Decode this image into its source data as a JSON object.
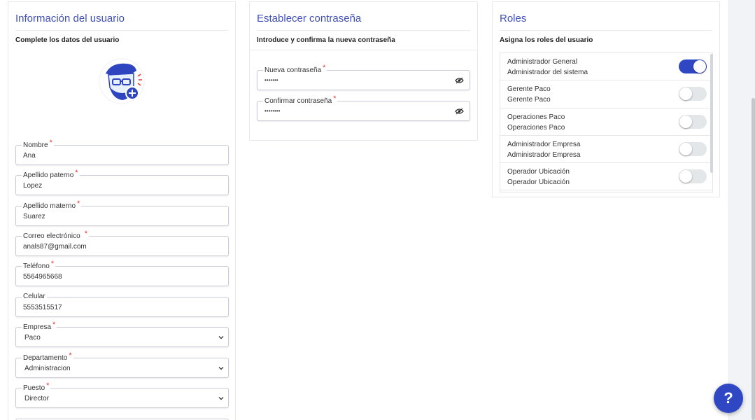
{
  "user_card": {
    "title": "Información del usuario",
    "subtitle": "Complete los datos del usuario",
    "fields": [
      {
        "label": "Nombre",
        "required": "*",
        "value": "Ana"
      },
      {
        "label": "Apellido paterno",
        "required": "*",
        "value": "Lopez"
      },
      {
        "label": "Apellido materno",
        "required": "*",
        "value": "Suarez"
      },
      {
        "label": "Correo electrónico",
        "required": "*",
        "value": "anals87@gmail.com"
      },
      {
        "label": "Teléfono",
        "required": "*",
        "value": "5564965668"
      },
      {
        "label": "Celular",
        "value": "5553515517"
      }
    ],
    "selects": [
      {
        "label": "Empresa",
        "required": "*",
        "value": "Paco"
      },
      {
        "label": "Departamento",
        "required": "*",
        "value": "Administracion"
      },
      {
        "label": "Puesto",
        "required": "*",
        "value": "Director"
      }
    ]
  },
  "password_card": {
    "title": "Establecer contraseña",
    "subtitle": "Introduce y confirma la nueva contraseña",
    "fields": [
      {
        "label": "Nueva contraseña",
        "required": "*",
        "value": "•••••••"
      },
      {
        "label": "Confirmar contraseña",
        "required": "*",
        "value": "••••••••"
      }
    ]
  },
  "roles_card": {
    "title": "Roles",
    "subtitle": "Asigna los roles del usuario",
    "roles": [
      {
        "name": "Administrador General",
        "description": "Administrador del sistema",
        "enabled": true
      },
      {
        "name": "Gerente Paco",
        "description": "Gerente Paco",
        "enabled": false
      },
      {
        "name": "Operaciones Paco",
        "description": "Operaciones Paco",
        "enabled": false
      },
      {
        "name": "Administrador Empresa",
        "description": "Administrador Empresa",
        "enabled": false
      },
      {
        "name": "Operador Ubicación",
        "description": "Operador Ubicación",
        "enabled": false
      }
    ]
  },
  "help_button": {
    "label": "?"
  },
  "colors": {
    "accent": "#3047c4",
    "title": "#3f51b5",
    "required": "#e53935"
  },
  "icons": [
    "user-avatar-icon",
    "eye-icon",
    "chevron-down-icon",
    "help-icon"
  ]
}
